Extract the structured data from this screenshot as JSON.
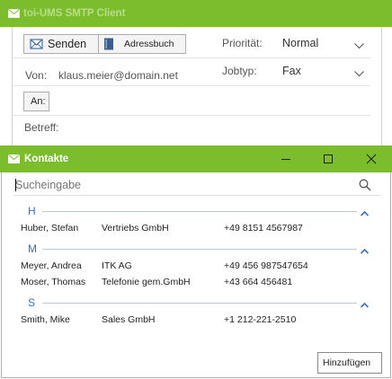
{
  "smtp_window": {
    "title": "toi-UMS SMTP Client",
    "toolbar": {
      "send_label": "Senden",
      "addressbook_label": "Adressbuch"
    },
    "from_label": "Von:",
    "from_value": "klaus.meier@domain.net",
    "priority_label": "Priorität:",
    "priority_value": "Normal",
    "jobtype_label": "Jobtyp:",
    "jobtype_value": "Fax",
    "to_button_label": "An:",
    "subject_label": "Betreff:"
  },
  "contacts_window": {
    "title": "Kontakte",
    "search": {
      "placeholder": "Sucheingabe",
      "value": ""
    },
    "groups": [
      {
        "letter": "H",
        "contacts": [
          {
            "name": "Huber, Stefan",
            "company": "Vertriebs GmbH",
            "phone": "+49 8151 4567987"
          }
        ]
      },
      {
        "letter": "M",
        "contacts": [
          {
            "name": "Meyer, Andrea",
            "company": "ITK AG",
            "phone": "+49 456 987547654"
          },
          {
            "name": "Moser, Thomas",
            "company": "Telefonie gem.GmbH",
            "phone": "+43 664 456481"
          }
        ]
      },
      {
        "letter": "S",
        "contacts": [
          {
            "name": "Smith, Mike",
            "company": "Sales GmbH",
            "phone": "+1 212-221-2510"
          }
        ]
      }
    ],
    "add_button_label": "Hinzufügen"
  },
  "colors": {
    "titlebar": "#7cbd2e",
    "group_letter": "#3b6fb6",
    "group_line": "#b9c9dd"
  }
}
